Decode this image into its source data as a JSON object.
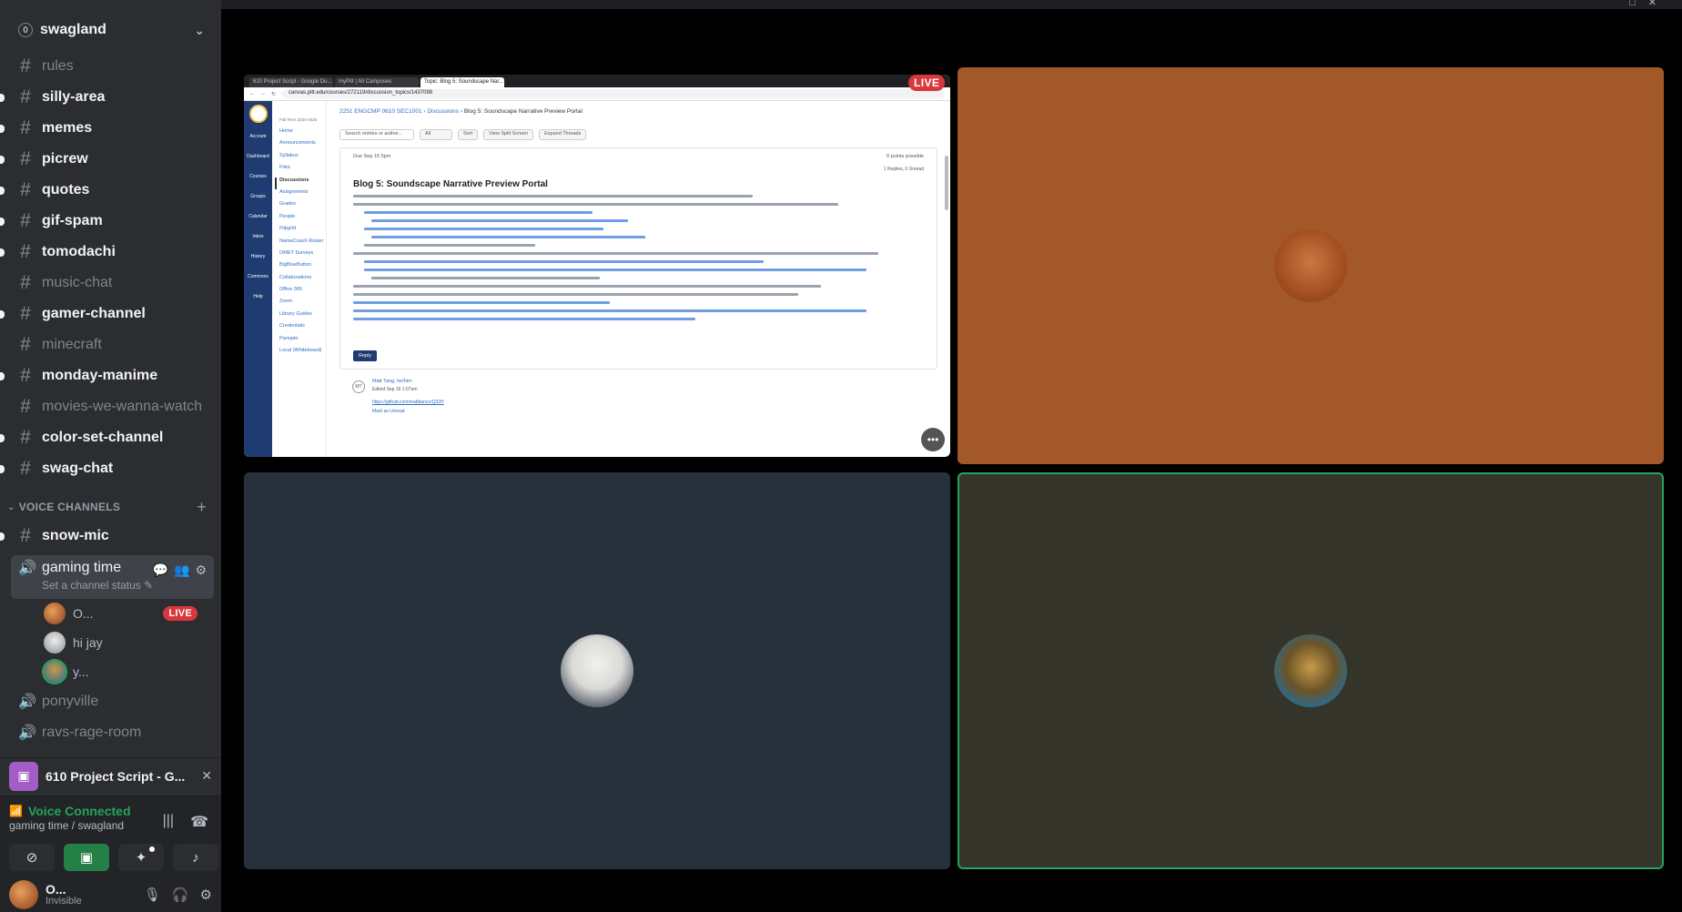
{
  "server": {
    "name": "swagland",
    "badge": "0"
  },
  "channels": [
    {
      "name": "rules",
      "unread": false
    },
    {
      "name": "silly-area",
      "unread": true
    },
    {
      "name": "memes",
      "unread": true
    },
    {
      "name": "picrew",
      "unread": true
    },
    {
      "name": "quotes",
      "unread": true
    },
    {
      "name": "gif-spam",
      "unread": true
    },
    {
      "name": "tomodachi",
      "unread": true
    },
    {
      "name": "music-chat",
      "unread": false
    },
    {
      "name": "gamer-channel",
      "unread": true
    },
    {
      "name": "minecraft",
      "unread": false
    },
    {
      "name": "monday-manime",
      "unread": true
    },
    {
      "name": "movies-we-wanna-watch",
      "unread": false
    },
    {
      "name": "color-set-channel",
      "unread": true
    },
    {
      "name": "swag-chat",
      "unread": true
    }
  ],
  "voice_section": {
    "label": "VOICE CHANNELS"
  },
  "snow_mic": "snow-mic",
  "active_voice": {
    "name": "gaming time",
    "status_placeholder": "Set a channel status",
    "users": [
      {
        "name": "O...",
        "live": true,
        "live_label": "LIVE"
      },
      {
        "name": "hi jay",
        "live": false
      },
      {
        "name": "y...",
        "live": false
      }
    ]
  },
  "other_voice": [
    "ponyville",
    "ravs-rage-room"
  ],
  "activity": {
    "title": "610 Project Script - G..."
  },
  "voice_panel": {
    "status": "Voice Connected",
    "location": "gaming time / swagland"
  },
  "user": {
    "name": "O...",
    "status": "Invisible"
  },
  "stage": {
    "live_label": "LIVE"
  },
  "stream": {
    "tabs": [
      "610 Project Script - Google Do...",
      "myPitt | All Campuses",
      "Topic: Blog 5: Soundscape Nar..."
    ],
    "url": "canvas.pitt.edu/courses/272119/discussion_topics/1437098",
    "breadcrumb": [
      "2251 ENGCMP 0610 SEC1001",
      "Discussions",
      "Blog 5: Soundscape Narrative Preview Portal"
    ],
    "nav": [
      "Account",
      "Dashboard",
      "Courses",
      "Groups",
      "Calendar",
      "Inbox",
      "History",
      "Commons",
      "Help"
    ],
    "course_nav": [
      "Home",
      "Announcements",
      "Syllabus",
      "Files",
      "Discussions",
      "Assignments",
      "Grades",
      "People",
      "Flipgrid",
      "NameCoach Roster",
      "OMET Surveys",
      "BigBlueButton",
      "Collaborations",
      "Office 365",
      "Zoom",
      "Library Guides",
      "Credentials",
      "Panopto",
      "Local (Whiteboard)"
    ],
    "term": "Fall Term 2024-2025",
    "search_placeholder": "Search entries or author...",
    "filter": "All",
    "sort": "Sort",
    "split": "View Split Screen",
    "expand": "Expand Threads",
    "due": "Due Sep 16 5pm",
    "points": "0 points possible",
    "replies": "1 Replies, 0 Unread",
    "title": "Blog 5: Soundscape Narrative Preview Portal",
    "reply": "Reply",
    "reply_author": "Matt Tang, he/him",
    "reply_meta": "Edited Sep 16 1:07am",
    "reply_link": "https://github.com/mattbanco/Q32H",
    "mark_unread": "Mark as Unread"
  }
}
